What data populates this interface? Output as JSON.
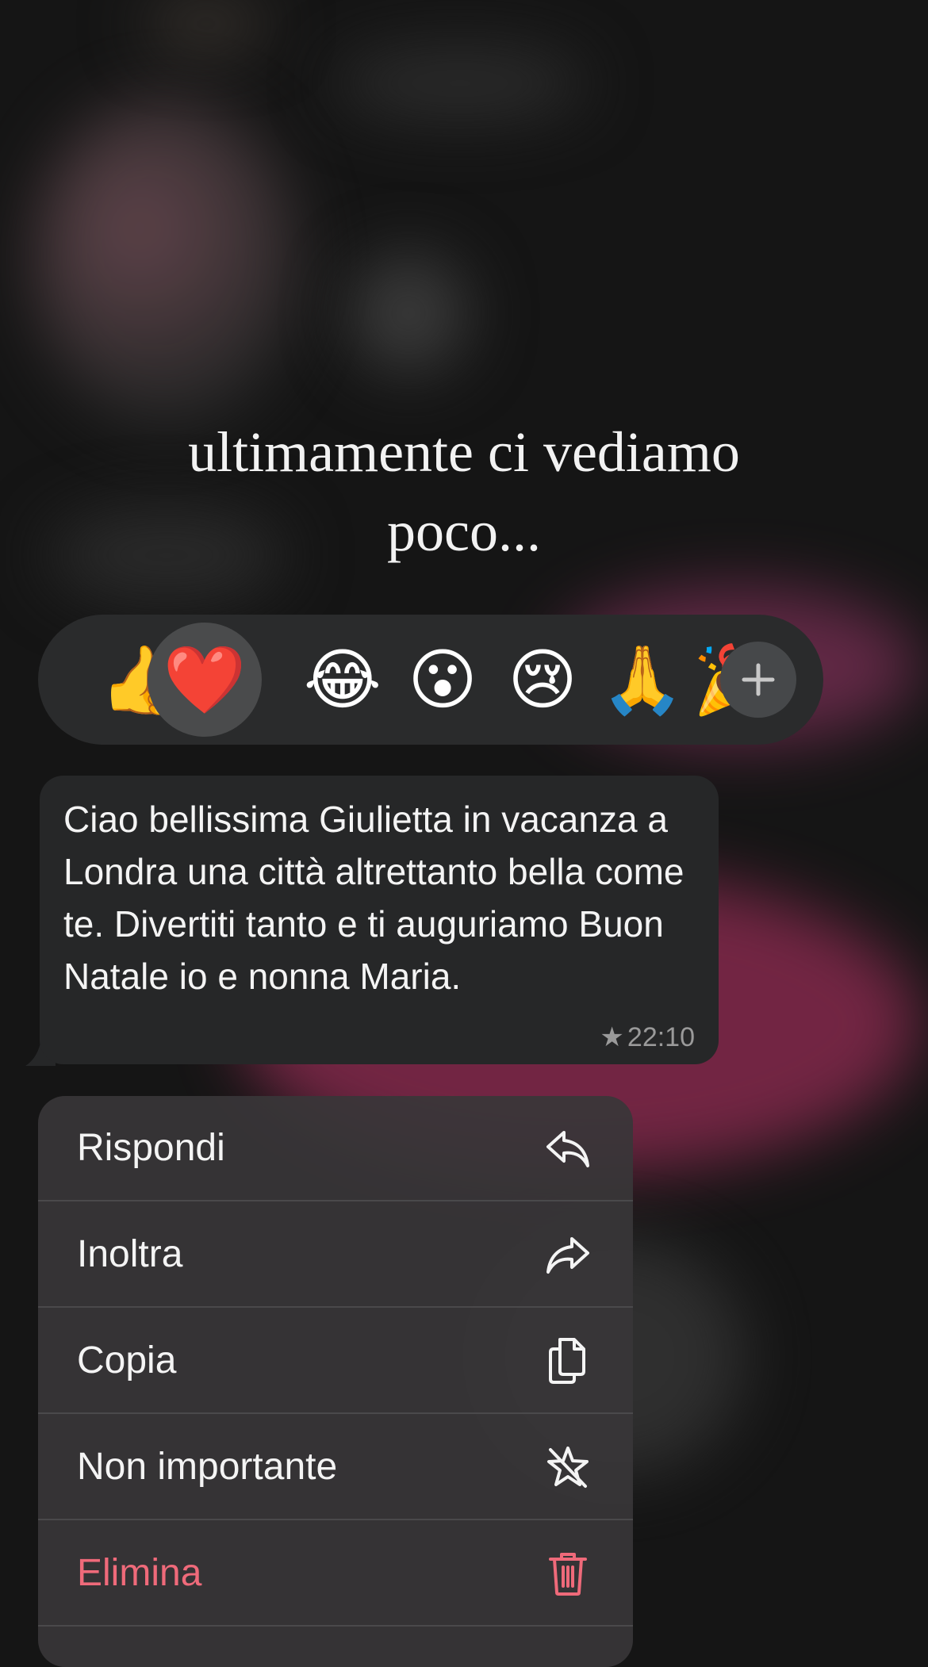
{
  "caption": {
    "line1": "ultimamente ci vediamo",
    "line2": "poco..."
  },
  "reactions": {
    "emojis": [
      "👍",
      "❤️",
      "😂",
      "😮",
      "😢",
      "🙏",
      "🎉"
    ],
    "selected": "❤️",
    "more_icon": "plus-icon"
  },
  "message": {
    "text": "Ciao bellissima Giulietta in vacanza a Londra una città  altrettanto bella come te. Divertiti tanto e ti auguriamo Buon Natale io e nonna Maria.",
    "star": "★",
    "time": "22:10"
  },
  "menu": {
    "items": [
      {
        "label": "Rispondi",
        "icon": "reply-icon"
      },
      {
        "label": "Inoltra",
        "icon": "forward-icon"
      },
      {
        "label": "Copia",
        "icon": "copy-icon"
      },
      {
        "label": "Non importante",
        "icon": "unstar-icon"
      },
      {
        "label": "Elimina",
        "icon": "trash-icon"
      }
    ]
  },
  "colors": {
    "danger": "#ef6a7a",
    "bubble": "#262728",
    "menu": "#383638"
  }
}
